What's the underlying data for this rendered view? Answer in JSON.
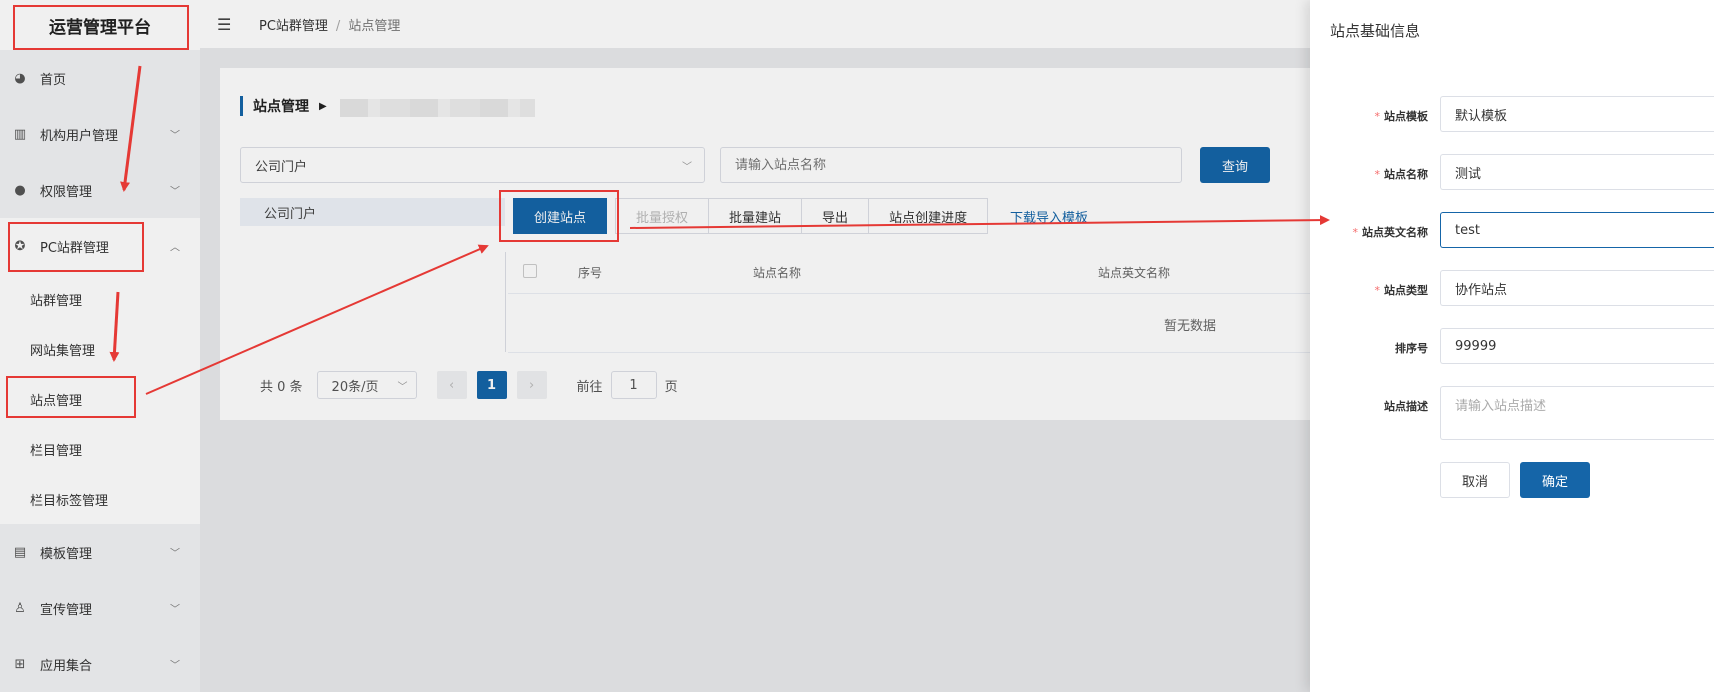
{
  "sidebar": {
    "logo": "运营管理平台",
    "items": [
      {
        "label": "首页",
        "icon": "dashboard-icon"
      },
      {
        "label": "机构用户管理",
        "icon": "building-icon"
      },
      {
        "label": "权限管理",
        "icon": "user-icon"
      },
      {
        "label": "PC站群管理",
        "icon": "target-icon"
      }
    ],
    "sub_items": [
      "站群管理",
      "网站集管理",
      "站点管理",
      "栏目管理",
      "栏目标签管理"
    ],
    "bottom_items": [
      {
        "label": "模板管理",
        "icon": "template-icon"
      },
      {
        "label": "宣传管理",
        "icon": "megaphone-icon"
      },
      {
        "label": "应用集合",
        "icon": "apps-icon"
      }
    ]
  },
  "topbar": {
    "breadcrumb": [
      "PC站群管理",
      "站点管理"
    ]
  },
  "main": {
    "title": "站点管理",
    "filter_select": "公司门户",
    "search_placeholder": "请输入站点名称",
    "query_button": "查询",
    "tree_item": "公司门户",
    "actions": [
      "创建站点",
      "批量授权",
      "批量建站",
      "导出",
      "站点创建进度"
    ],
    "download_link": "下载导入模板",
    "table_headers": [
      "序号",
      "站点名称",
      "站点英文名称"
    ],
    "empty_text": "暂无数据",
    "pager": {
      "total": "共 0 条",
      "page_size": "20条/页",
      "current_page": "1",
      "goto_label": "前往",
      "goto_value": "1",
      "goto_suffix": "页"
    }
  },
  "drawer": {
    "title": "站点基础信息",
    "fields": [
      {
        "label": "站点模板",
        "required": true,
        "value": "默认模板"
      },
      {
        "label": "站点名称",
        "required": true,
        "value": "测试"
      },
      {
        "label": "站点英文名称",
        "required": true,
        "value": "test"
      },
      {
        "label": "站点类型",
        "required": true,
        "value": "协作站点"
      },
      {
        "label": "排序号",
        "required": false,
        "value": "99999"
      }
    ],
    "description_label": "站点描述",
    "description_placeholder": "请输入站点描述",
    "cancel": "取消",
    "confirm": "确定"
  },
  "colors": {
    "primary": "#1565a8",
    "annotation": "#e53935",
    "required": "#f56c6c"
  }
}
